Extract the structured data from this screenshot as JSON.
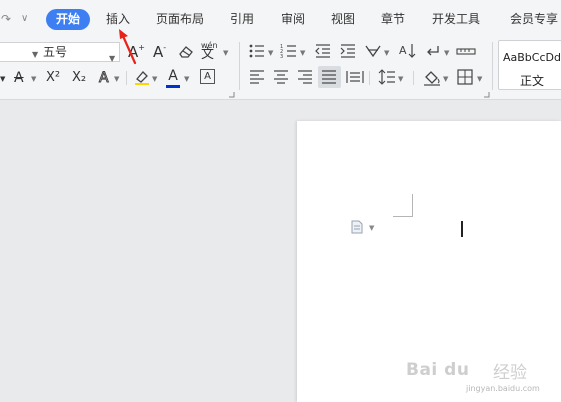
{
  "menubar": {
    "quick_redo_glyph": "↷",
    "quick_more_glyph": "∨",
    "tabs": [
      {
        "label": "开始",
        "active": true
      },
      {
        "label": "插入"
      },
      {
        "label": "页面布局"
      },
      {
        "label": "引用"
      },
      {
        "label": "审阅"
      },
      {
        "label": "视图"
      },
      {
        "label": "章节"
      },
      {
        "label": "开发工具"
      },
      {
        "label": "会员专享"
      }
    ]
  },
  "ribbon": {
    "font_size_value": "五号",
    "phonetic_guide_label": "wén",
    "superscript_label": "X²",
    "subscript_label": "X₂",
    "font_color_label": "A",
    "char_border_label": "A",
    "grow_font_label": "A",
    "shrink_font_label": "A",
    "style_gallery": {
      "sample_text": "AaBbCcDd",
      "style_name": "正文"
    },
    "colors": {
      "font_color_bar": "#0033cc",
      "highlight_bar": "#ffd400"
    }
  },
  "annotation": {
    "arrow_color": "#e8231a"
  },
  "watermark": {
    "logo_text": "Bai du",
    "cn_text": "经验",
    "url_text": "jingyan.baidu.com"
  }
}
